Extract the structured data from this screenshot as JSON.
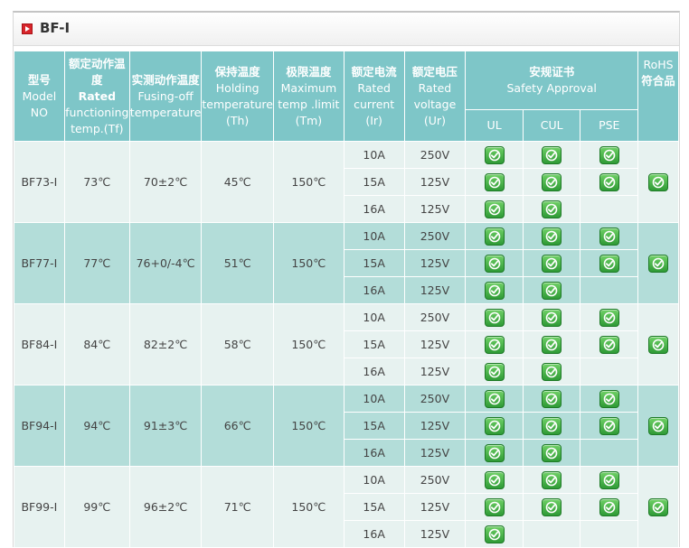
{
  "title": "BF-I",
  "headers": {
    "model": [
      "型号",
      "Model",
      "NO"
    ],
    "rated_temp": {
      "zh": "额定动作温度",
      "en_bold": "Rated",
      "en": "functioning temp.(Tf)"
    },
    "fusing_temp": {
      "zh": "实测动作温度",
      "en": "Fusing-off temperature"
    },
    "holding_temp": {
      "zh": "保持温度",
      "en": "Holding temperature",
      "sym": "(Th)"
    },
    "max_temp": {
      "zh": "极限温度",
      "en": "Maximum temp .limit",
      "sym": "(Tm)"
    },
    "rated_current": {
      "zh": "额定电流",
      "en": "Rated current",
      "sym": "(Ir)"
    },
    "rated_voltage": {
      "zh": "额定电压",
      "en": "Rated voltage",
      "sym": "(Ur)"
    },
    "safety": {
      "zh": "安规证书",
      "en": "Safety Approval"
    },
    "rohs": {
      "en": "RoHS",
      "zh": "符合品"
    },
    "cert_cols": [
      "UL",
      "CUL",
      "PSE"
    ]
  },
  "icons": {
    "approved": "check-approved-icon",
    "color": "#3aa83f"
  },
  "rows": [
    {
      "model": "BF73-I",
      "tf": "73℃",
      "fusing": "70±2℃",
      "th": "45℃",
      "tm": "150℃",
      "rohs": true,
      "sub": [
        {
          "ir": "10A",
          "ur": "250V",
          "ul": true,
          "cul": true,
          "pse": true
        },
        {
          "ir": "15A",
          "ur": "125V",
          "ul": true,
          "cul": true,
          "pse": true
        },
        {
          "ir": "16A",
          "ur": "125V",
          "ul": true,
          "cul": true,
          "pse": false
        }
      ]
    },
    {
      "model": "BF77-I",
      "tf": "77℃",
      "fusing": "76+0/-4℃",
      "th": "51℃",
      "tm": "150℃",
      "rohs": true,
      "sub": [
        {
          "ir": "10A",
          "ur": "250V",
          "ul": true,
          "cul": true,
          "pse": true
        },
        {
          "ir": "15A",
          "ur": "125V",
          "ul": true,
          "cul": true,
          "pse": true
        },
        {
          "ir": "16A",
          "ur": "125V",
          "ul": true,
          "cul": true,
          "pse": false
        }
      ]
    },
    {
      "model": "BF84-I",
      "tf": "84℃",
      "fusing": "82±2℃",
      "th": "58℃",
      "tm": "150℃",
      "rohs": true,
      "sub": [
        {
          "ir": "10A",
          "ur": "250V",
          "ul": true,
          "cul": true,
          "pse": true
        },
        {
          "ir": "15A",
          "ur": "125V",
          "ul": true,
          "cul": true,
          "pse": true
        },
        {
          "ir": "16A",
          "ur": "125V",
          "ul": true,
          "cul": true,
          "pse": false
        }
      ]
    },
    {
      "model": "BF94-I",
      "tf": "94℃",
      "fusing": "91±3℃",
      "th": "66℃",
      "tm": "150℃",
      "rohs": true,
      "sub": [
        {
          "ir": "10A",
          "ur": "250V",
          "ul": true,
          "cul": true,
          "pse": true
        },
        {
          "ir": "15A",
          "ur": "125V",
          "ul": true,
          "cul": true,
          "pse": true
        },
        {
          "ir": "16A",
          "ur": "125V",
          "ul": true,
          "cul": true,
          "pse": false
        }
      ]
    },
    {
      "model": "BF99-I",
      "tf": "99℃",
      "fusing": "96±2℃",
      "th": "71℃",
      "tm": "150℃",
      "rohs": true,
      "sub": [
        {
          "ir": "10A",
          "ur": "250V",
          "ul": true,
          "cul": true,
          "pse": true
        },
        {
          "ir": "15A",
          "ur": "125V",
          "ul": true,
          "cul": true,
          "pse": true
        },
        {
          "ir": "16A",
          "ur": "125V",
          "ul": true,
          "cul": false,
          "pse": false
        }
      ]
    }
  ]
}
